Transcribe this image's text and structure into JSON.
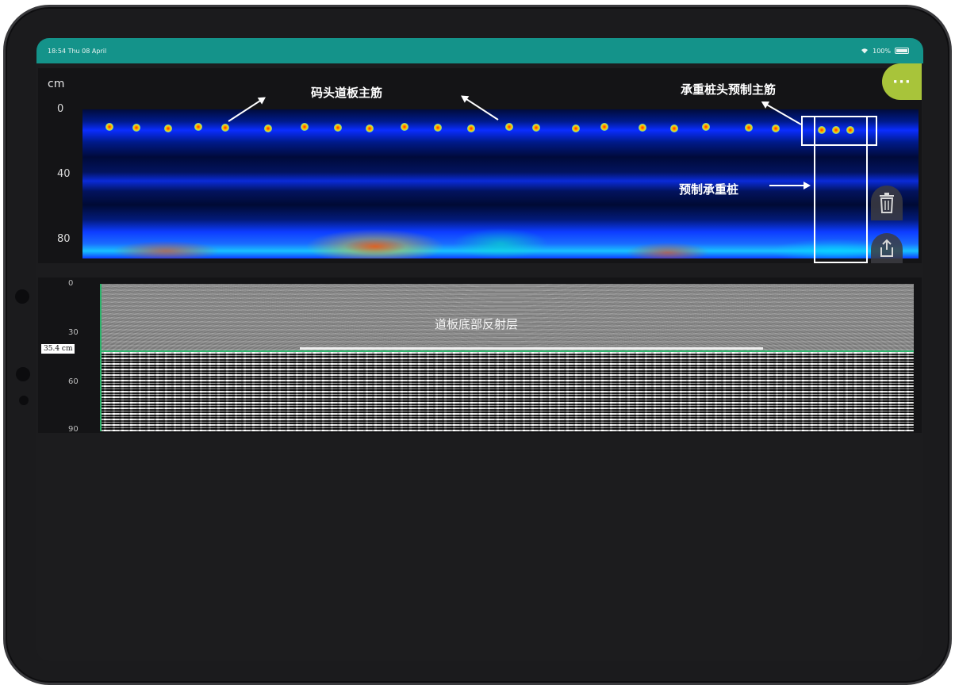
{
  "status_bar": {
    "time_date": "18:54 Thu 08 April",
    "battery": "100%"
  },
  "scan_panel": {
    "unit": "cm",
    "y_ticks": [
      "0",
      "40",
      "80"
    ],
    "annotation_slab_rebar": "码头道板主筋",
    "annotation_pile_head_rebar": "承重桩头预制主筋",
    "annotation_precast_pile": "预制承重桩"
  },
  "radar_panel": {
    "y_ticks": [
      "0",
      "30",
      "60",
      "90"
    ],
    "depth_marker": "35.4 cm",
    "annotation_reflection": "道板底部反射层"
  },
  "toolbar": {
    "more_icon": "more-dots-icon",
    "delete_icon": "trash-icon",
    "share_icon": "share-icon"
  },
  "colors": {
    "status_bar": "#14938a",
    "more_button": "#a8c43a",
    "guide_line": "#2bb46b"
  }
}
